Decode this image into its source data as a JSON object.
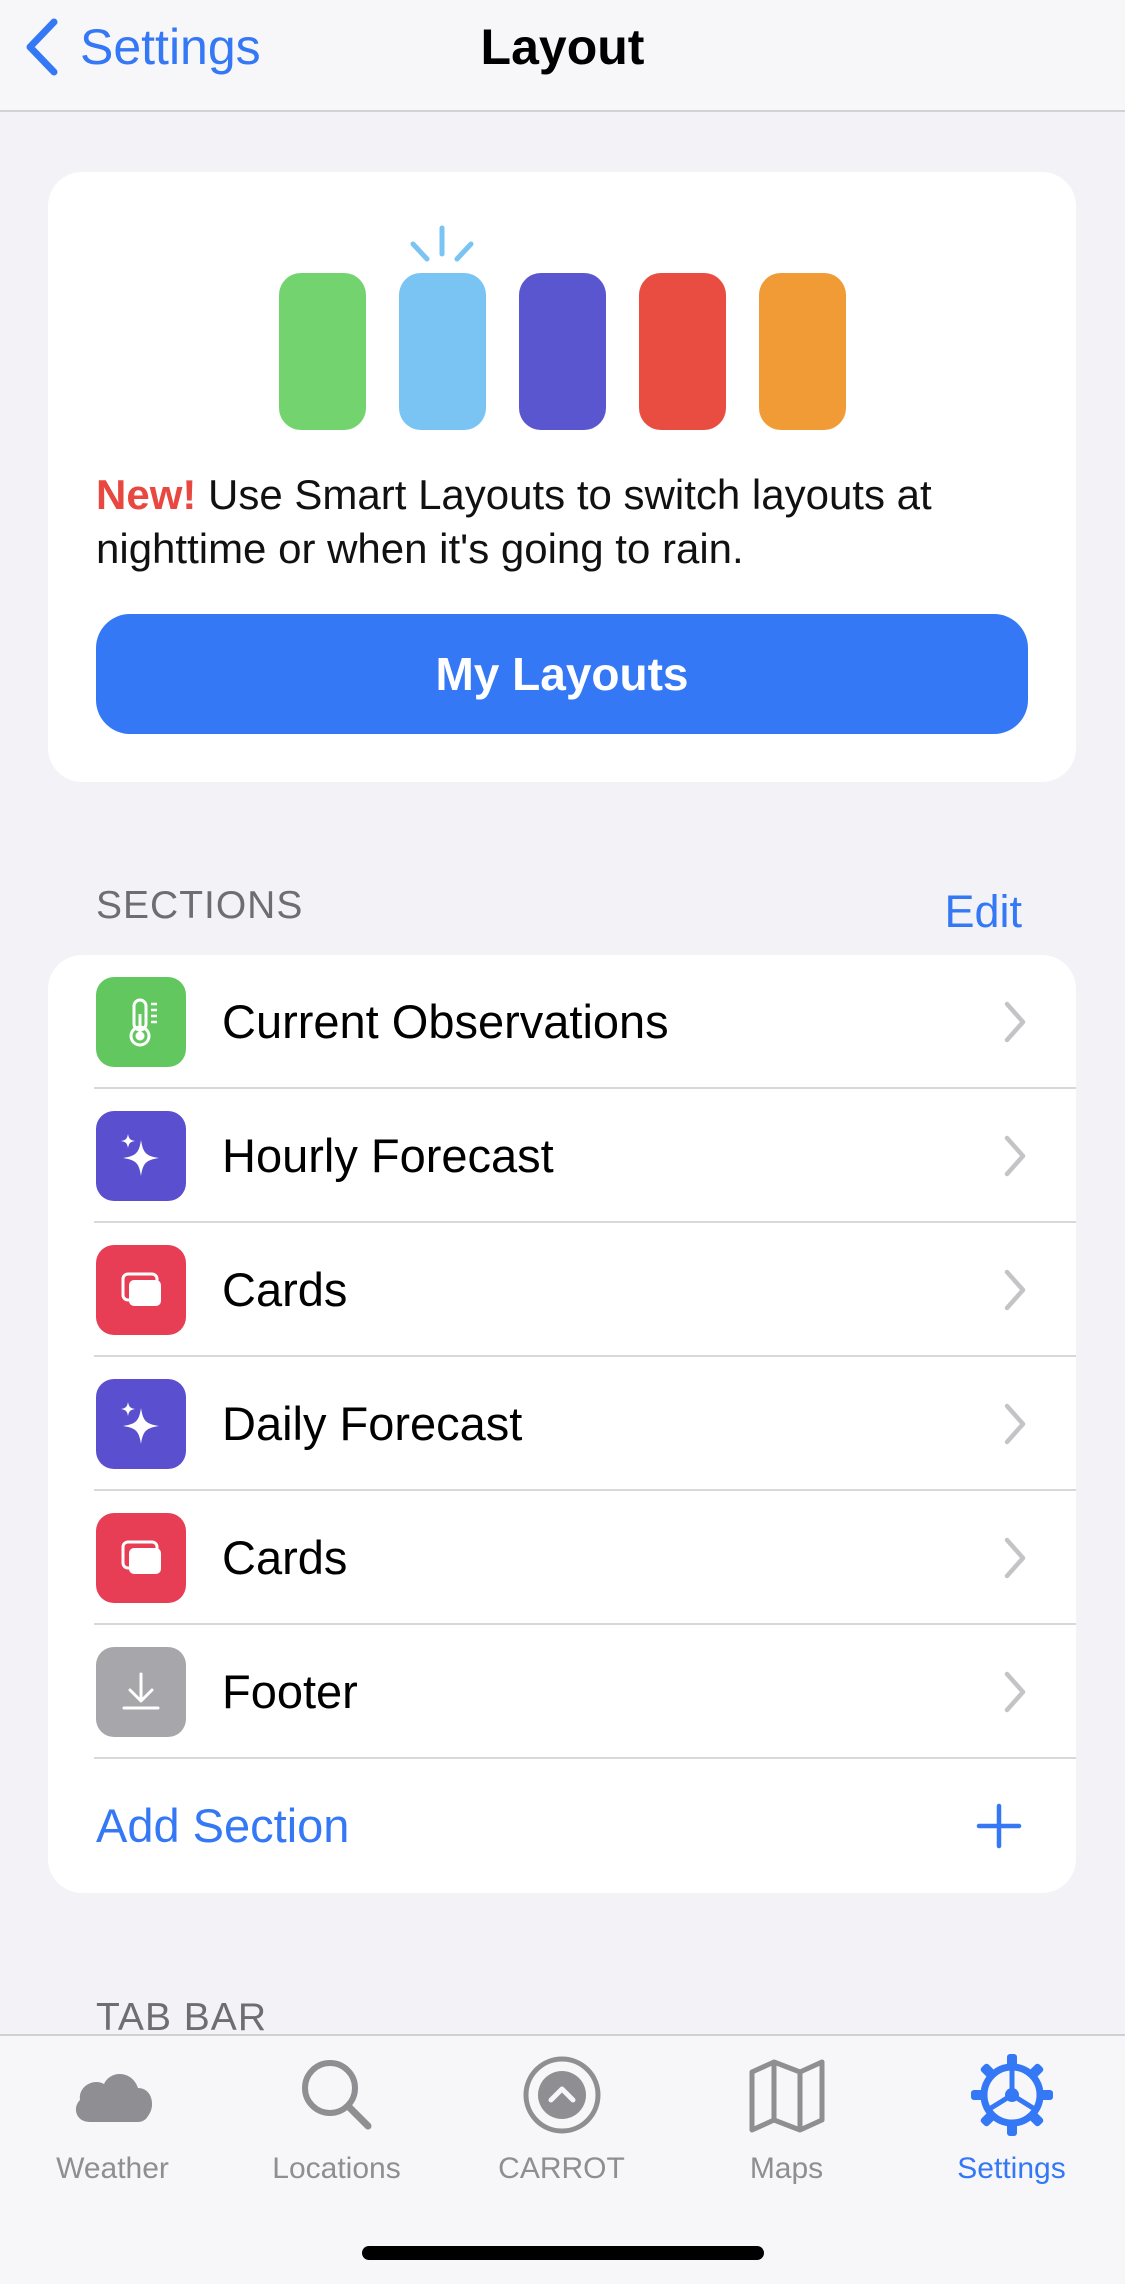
{
  "nav": {
    "back_label": "Settings",
    "title": "Layout"
  },
  "promo": {
    "badge": "New!",
    "text": "Use Smart Layouts to switch layouts at nighttime or when it's going to rain.",
    "button_label": "My Layouts",
    "swatch_colors": [
      "#73d46f",
      "#79c4f3",
      "#5956cf",
      "#e94c40",
      "#f09b36"
    ],
    "highlight_color": "#79c4f3"
  },
  "sections": {
    "header": "SECTIONS",
    "edit_label": "Edit",
    "items": [
      {
        "label": "Current Observations",
        "icon": "thermometer-icon",
        "icon_color": "#62c75e"
      },
      {
        "label": "Hourly Forecast",
        "icon": "sparkles-icon",
        "icon_color": "#5a4fcf"
      },
      {
        "label": "Cards",
        "icon": "cards-icon",
        "icon_color": "#e83e55"
      },
      {
        "label": "Daily Forecast",
        "icon": "sparkles-icon",
        "icon_color": "#5a4fcf"
      },
      {
        "label": "Cards",
        "icon": "cards-icon",
        "icon_color": "#e83e55"
      },
      {
        "label": "Footer",
        "icon": "download-icon",
        "icon_color": "#a7a7ab"
      }
    ],
    "add_label": "Add Section"
  },
  "tab_bar_section": {
    "header": "TAB BAR"
  },
  "tabbar": {
    "tabs": [
      {
        "label": "Weather",
        "icon": "cloud-icon"
      },
      {
        "label": "Locations",
        "icon": "search-icon"
      },
      {
        "label": "CARROT",
        "icon": "carrot-icon"
      },
      {
        "label": "Maps",
        "icon": "map-icon"
      },
      {
        "label": "Settings",
        "icon": "gear-icon",
        "active": true
      }
    ],
    "active_color": "#3478f6",
    "inactive_color": "#8e8e93"
  },
  "accent_color": "#3478f6"
}
